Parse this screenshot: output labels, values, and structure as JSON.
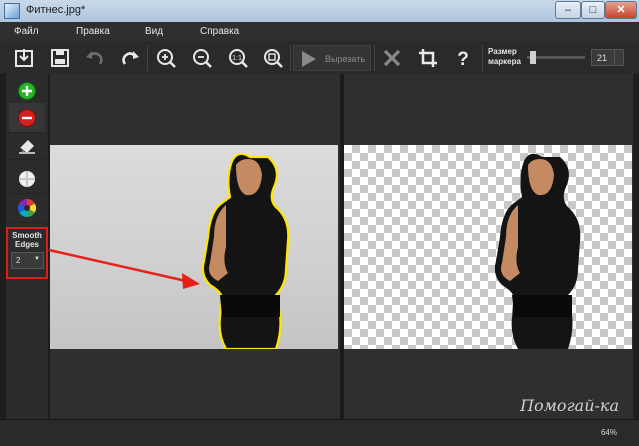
{
  "window": {
    "title": "Фитнес.jpg*",
    "min_label": "–",
    "max_label": "□",
    "close_label": "✕"
  },
  "menu": [
    "Файл",
    "Правка",
    "Вид",
    "Справка"
  ],
  "toolbar": {
    "icons": [
      "save-as-icon",
      "save-icon",
      "undo-icon",
      "redo-icon",
      "zoom-in-icon",
      "zoom-out-icon",
      "zoom-actual-icon",
      "zoom-fit-icon",
      "close-icon",
      "crop-icon",
      "help-icon"
    ],
    "cut_label": "Вырезать",
    "marker_label_1": "Размер",
    "marker_label_2": "маркера",
    "marker_value": "21",
    "marker_level": 0.05
  },
  "side_tools": [
    "add-area-icon",
    "remove-area-icon",
    "eraser-icon",
    "background-icon",
    "color-wheel-icon"
  ],
  "smooth": {
    "label_1": "Smooth",
    "label_2": "Edges",
    "value": "2"
  },
  "status": {
    "zoom": "64%"
  },
  "watermark": "Помогай-ка",
  "colors": {
    "accent_red": "#d8201a",
    "outline_yellow": "#ffe600",
    "add_green": "#28b428",
    "remove_red": "#d32020"
  }
}
